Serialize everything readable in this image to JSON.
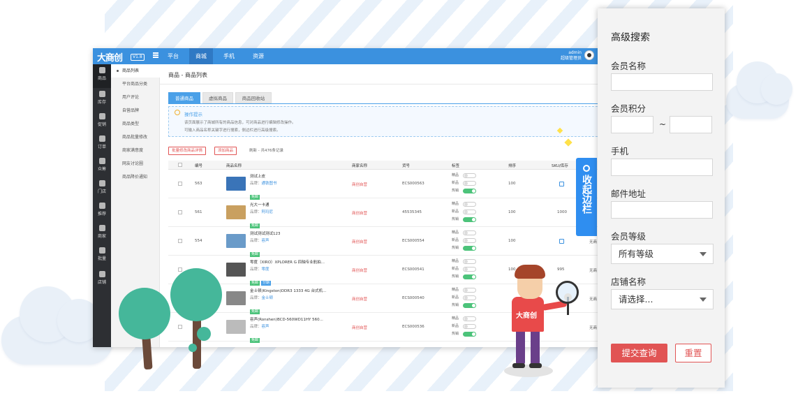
{
  "app": {
    "logo": "大商创",
    "version": "V1.8",
    "nav": [
      "平台",
      "商城",
      "手机",
      "资源"
    ],
    "active_nav": "商城",
    "admin_name": "admin",
    "admin_role": "超级管理员"
  },
  "sidebar": {
    "items": [
      "商品",
      "库存",
      "促销",
      "订单",
      "众筹",
      "门店",
      "推荐",
      "商家",
      "批量",
      "店铺"
    ]
  },
  "subnav": {
    "items": [
      "商品列表",
      "平台商品分类",
      "用户评论",
      "自营品牌",
      "商品类型",
      "商品批量修改",
      "商家满意度",
      "网友讨论圈",
      "商品降价通知"
    ]
  },
  "breadcrumb": "商品 - 商品列表",
  "content_tabs": [
    "普通商品",
    "虚拟商品",
    "商品回收站"
  ],
  "tips": {
    "title": "操作提示",
    "lines": [
      "该页面展示了商城所有的商品信息，可对商品进行编辑修改操作。",
      "可输入商品名称关键字进行搜索，侧边栏进行高级搜索。"
    ]
  },
  "actions": {
    "batch_edit": "批量修改商品详情",
    "add_goods": "添加商品",
    "refresh": "刷新 - 共476条记录"
  },
  "table": {
    "headers": [
      "编号",
      "商品名称",
      "商家名称",
      "货号",
      "标签",
      "排序",
      "SKU/库存"
    ],
    "tag_labels": [
      "精品",
      "新品",
      "热销"
    ],
    "rows": [
      {
        "id": "563",
        "name": "测试上皮",
        "brand_label": "品牌：",
        "brand": "通铁图书",
        "badges": [
          "免邮"
        ],
        "shop": "商创自营",
        "sku": "ECS000563",
        "sort": "100",
        "stock": "",
        "tags": [
          false,
          false,
          true
        ]
      },
      {
        "id": "561",
        "name": "光大一卡通",
        "brand_label": "品牌：",
        "brand": "阿玛尼",
        "badges": [
          "免邮"
        ],
        "shop": "商创自营",
        "sku": "45535345",
        "sort": "100",
        "stock": "1000",
        "tags": [
          false,
          false,
          true
        ]
      },
      {
        "id": "554",
        "name": "测试测试测试123",
        "brand_label": "品牌：",
        "brand": "容声",
        "badges": [
          "免邮"
        ],
        "shop": "商创自营",
        "sku": "ECS000554",
        "sort": "100",
        "stock": "",
        "tags": [
          false,
          false,
          true
        ]
      },
      {
        "id": "",
        "name": "零度（XIRO）XPLORER G 四轴专业航拍...",
        "brand_label": "品牌：",
        "brand": "零度",
        "badges": [
          "免邮",
          "分期"
        ],
        "shop": "商创自营",
        "sku": "ECS000541",
        "sort": "100",
        "stock": "995",
        "tags": [
          false,
          false,
          true
        ]
      },
      {
        "id": "",
        "name": "金士顿(Kingston)DDR3 1333 4G 台式机...",
        "brand_label": "品牌：",
        "brand": "金士顿",
        "badges": [
          "免邮"
        ],
        "shop": "商创自营",
        "sku": "ECS000540",
        "sort": "",
        "stock": "",
        "tags": [
          false,
          false,
          true
        ]
      },
      {
        "id": "",
        "name": "容声(Ronshen)BCD-560WD11HY 560...",
        "brand_label": "品牌：",
        "brand": "容声",
        "badges": [
          "免邮"
        ],
        "shop": "商创自营",
        "sku": "ECS000536",
        "sort": "",
        "stock": "",
        "tags": [
          false,
          false,
          true
        ]
      }
    ],
    "row_tail": "无商"
  },
  "collapse_button": "收起边栏",
  "panel": {
    "title": "高级搜索",
    "member_name_label": "会员名称",
    "member_points_label": "会员积分",
    "range_sep": "~",
    "phone_label": "手机",
    "email_label": "邮件地址",
    "member_level_label": "会员等级",
    "member_level_value": "所有等级",
    "shop_name_label": "店铺名称",
    "shop_name_value": "请选择...",
    "submit_label": "提交查询",
    "reset_label": "重置"
  },
  "mascot": {
    "shirt_text": "大商创"
  },
  "colors": {
    "topbar": "#3b91df",
    "accent_red": "#e15454",
    "sidebar": "#2d2f33",
    "collapse_blue": "#2f8ef0",
    "tree_green": "#45b79a"
  }
}
